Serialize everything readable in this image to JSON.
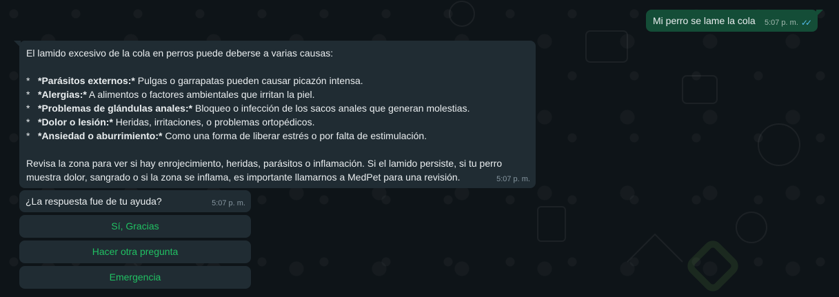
{
  "outgoing": {
    "text": "Mi perro se lame la cola",
    "time": "5:07 p. m."
  },
  "answer": {
    "intro": "El lamido excesivo de la cola en perros puede deberse a varias causas:",
    "items": [
      {
        "bullet": "*",
        "title": "*Parásitos externos:*",
        "text": " Pulgas o garrapatas pueden causar picazón intensa."
      },
      {
        "bullet": "*",
        "title": "*Alergias:*",
        "text": " A alimentos o factores ambientales que irritan la piel."
      },
      {
        "bullet": "*",
        "title": "*Problemas de glándulas anales:*",
        "text": " Bloqueo o infección de los sacos anales que generan molestias."
      },
      {
        "bullet": "*",
        "title": "*Dolor o lesión:*",
        "text": " Heridas, irritaciones, o problemas ortopédicos."
      },
      {
        "bullet": "*",
        "title": "*Ansiedad o aburrimiento:*",
        "text": " Como una forma de liberar estrés o por falta de estimulación."
      }
    ],
    "outro": "Revisa la zona para ver si hay enrojecimiento, heridas, parásitos o inflamación. Si el lamido persiste, si tu perro muestra dolor, sangrado o si la zona se inflama, es importante llamarnos a MedPet para una revisión.",
    "time": "5:07 p. m."
  },
  "question": {
    "text": "¿La respuesta fue de tu ayuda?",
    "time": "5:07 p. m."
  },
  "buttons": {
    "yes": "Sí, Gracias",
    "another": "Hacer otra pregunta",
    "emergency": "Emergencia"
  },
  "colors": {
    "outgoing_bubble": "#144d37",
    "incoming_bubble": "#202c33",
    "button_text": "#21c063",
    "read_ticks": "#53bdeb"
  }
}
